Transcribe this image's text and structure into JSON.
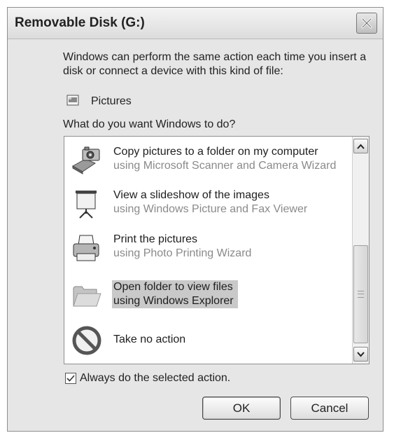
{
  "window": {
    "title": "Removable Disk (G:)"
  },
  "intro_text": "Windows can perform the same action each time you insert a disk or connect a device with this kind of file:",
  "content_type": {
    "icon": "pictures-icon",
    "label": "Pictures"
  },
  "question": "What do you want Windows to do?",
  "options": [
    {
      "icon": "camera-scanner-icon",
      "title": "Copy pictures to a folder on my computer",
      "subtitle": "using Microsoft Scanner and Camera Wizard",
      "selected": false
    },
    {
      "icon": "projector-screen-icon",
      "title": "View a slideshow of the images",
      "subtitle": "using Windows Picture and Fax Viewer",
      "selected": false
    },
    {
      "icon": "printer-icon",
      "title": "Print the pictures",
      "subtitle": "using Photo Printing Wizard",
      "selected": false
    },
    {
      "icon": "folder-icon",
      "title": "Open folder to view files",
      "subtitle": "using Windows Explorer",
      "selected": true
    },
    {
      "icon": "no-action-icon",
      "title": "Take no action",
      "subtitle": "",
      "selected": false
    }
  ],
  "always_checkbox": {
    "label": "Always do the selected action.",
    "checked": true
  },
  "buttons": {
    "ok_label": "OK",
    "cancel_label": "Cancel"
  },
  "colors": {
    "dialog_bg": "#e6e6e6",
    "selection": "#c9c9c9",
    "subtitle": "#8a8a8a"
  }
}
